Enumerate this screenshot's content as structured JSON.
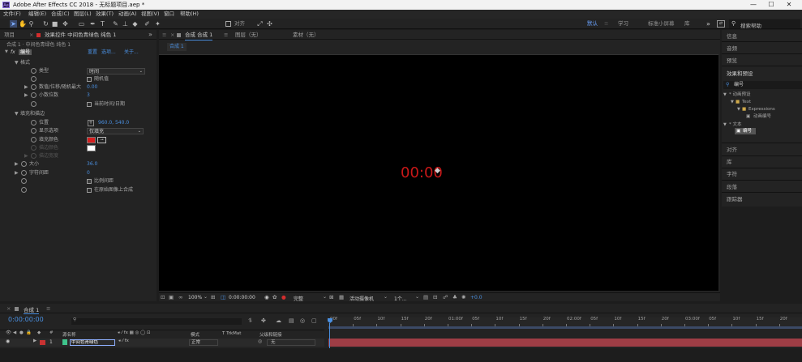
{
  "app": {
    "logo": "Ae",
    "title": "Adobe After Effects CC 2018 - 无标题项目.aep *"
  },
  "window_controls": {
    "minimize": "—",
    "maximize": "☐",
    "close": "✕"
  },
  "menu": [
    "文件(F)",
    "编辑(E)",
    "合成(C)",
    "图层(L)",
    "效果(T)",
    "动画(A)",
    "视图(V)",
    "窗口",
    "帮助(H)"
  ],
  "toolbar": {
    "align_label": "对齐",
    "workspaces": [
      "默认",
      "学习",
      "标准",
      "小屏幕",
      "库"
    ],
    "current_workspace": "默认",
    "more": "»",
    "search_placeholder": "搜索帮助"
  },
  "effect_controls": {
    "left_tab": "项目",
    "tab_label": "效果控件 中间色青绿色 纯色 1",
    "layer_path": "合成 1 · 中间色青绿色 纯色 1",
    "effect_name": "编号",
    "reset": "重置",
    "options": "选项...",
    "about": "关于...",
    "rows": {
      "format": "格式",
      "type": "类型",
      "type_value": "时间",
      "random_values": "随机值",
      "value_offset": "数值/位移/随机最大",
      "value_offset_val": "0.00",
      "decimal_places": "小数位数",
      "decimal_places_val": "3",
      "current_time": "当前时间/日期",
      "fill_stroke": "填充和描边",
      "position": "位置",
      "position_val": "960.0, 540.0",
      "display_options": "显示选项",
      "display_val": "仅填充",
      "fill_color": "填充颜色",
      "stroke_color": "描边颜色",
      "stroke_width": "描边宽度",
      "size": "大小",
      "size_val": "36.0",
      "tracking": "字符间距",
      "tracking_val": "0",
      "proportional_spacing": "比例间距",
      "composite_on_original": "在原始图像上合成"
    }
  },
  "composition": {
    "tab_label": "合成 合成 1",
    "layer_tab": "图层（无）",
    "footage_tab": "素材（无）",
    "breadcrumb": "合成 1",
    "viewer_text": "00:00",
    "viewer_text_color": "#c81818",
    "footer": {
      "zoom": "100%",
      "timecode": "0:00:00:00",
      "resolution": "完整",
      "camera": "活动摄像机",
      "views": "1个...",
      "exposure": "+0.0"
    }
  },
  "right_panel": {
    "items_top": [
      "信息",
      "音频",
      "预览"
    ],
    "effects_presets": "效果和预设",
    "search_value": "编号",
    "tree": {
      "animation_presets": "* 动画预设",
      "text": "Text",
      "expressions": "Expressions",
      "expr_item": "动画编号",
      "text_group": "* 文本",
      "text_item": "编号"
    },
    "items_bottom": [
      "对齐",
      "库",
      "字符",
      "段落",
      "跟踪器"
    ]
  },
  "timeline": {
    "tab_label": "合成 1",
    "timecode": "0:00:00:00",
    "columns": {
      "source_name": "源名称",
      "mode": "模式",
      "trkmat": "T  TrkMat",
      "parent": "父级和链接"
    },
    "ruler": [
      "00f",
      "05f",
      "10f",
      "15f",
      "20f",
      "01:00f",
      "05f",
      "10f",
      "15f",
      "20f",
      "02:00f",
      "05f",
      "10f",
      "15f",
      "20f",
      "03:00f",
      "05f",
      "10f",
      "15f",
      "20f"
    ],
    "layer": {
      "number": "1",
      "name": "中间色青绿色",
      "label_color": "#3fc48c",
      "mode": "正常",
      "parent": "无"
    },
    "bar_color": "#9e3d45"
  },
  "colors": {
    "accent": "#4a8fe0",
    "fill_color": "#d61f1f",
    "stroke_color": "#ffffff"
  }
}
